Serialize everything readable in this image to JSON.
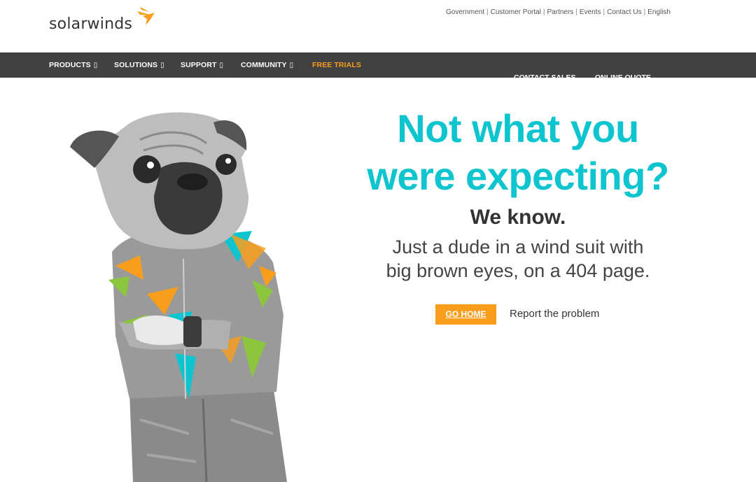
{
  "brand": {
    "name": "solarwinds",
    "accent": "#f99d1c",
    "headline_color": "#0ec5cf",
    "nav_bg": "#414141"
  },
  "utility_nav": {
    "items": [
      "Government",
      "Customer Portal",
      "Partners",
      "Events",
      "Contact Us",
      "English"
    ]
  },
  "main_nav": {
    "items": [
      {
        "label": "PRODUCTS",
        "icon": "▯"
      },
      {
        "label": "SOLUTIONS",
        "icon": "▯"
      },
      {
        "label": "SUPPORT",
        "icon": "▯"
      },
      {
        "label": "COMMUNITY",
        "icon": "▯"
      }
    ],
    "free_trials": "FREE TRIALS",
    "contact_sales": "CONTACT SALES",
    "online_quote": "ONLINE QUOTE"
  },
  "hero": {
    "headline_line1": "Not what you",
    "headline_line2": "were expecting?",
    "subhead": "We know.",
    "body_line1": "Just a dude in a wind suit with",
    "body_line2": "big brown eyes, on a 404 page.",
    "go_home": "GO HOME",
    "report": "Report the problem",
    "image": "pug-in-windsuit-illustration"
  }
}
